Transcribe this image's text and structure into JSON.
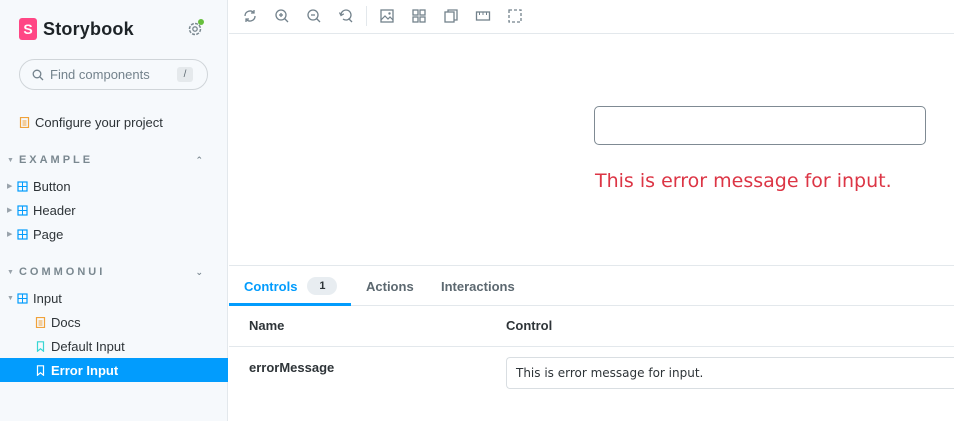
{
  "brand": {
    "name": "Storybook",
    "logo_letter": "S",
    "accent": "#ff4785"
  },
  "search": {
    "placeholder": "Find components",
    "shortcut": "/"
  },
  "sidebar": {
    "configure": "Configure your project",
    "sections": [
      {
        "title": "EXAMPLE",
        "items": [
          "Button",
          "Header",
          "Page"
        ]
      },
      {
        "title": "COMMONUI",
        "component": "Input",
        "stories": [
          "Docs",
          "Default Input",
          "Error Input"
        ]
      }
    ],
    "selected_color": "#029cfd"
  },
  "toolbar": {
    "icons": [
      "reload-icon",
      "zoom-in-icon",
      "zoom-out-icon",
      "zoom-reset-icon",
      "background-icon",
      "grid-icon",
      "viewport-icon",
      "measure-icon",
      "outline-icon"
    ]
  },
  "canvas": {
    "error_message": "This is error message for input.",
    "error_color": "#dc3545"
  },
  "panel": {
    "tabs": [
      {
        "label": "Controls",
        "badge": "1"
      },
      {
        "label": "Actions"
      },
      {
        "label": "Interactions"
      }
    ],
    "columns": {
      "name": "Name",
      "control": "Control"
    },
    "rows": [
      {
        "name": "errorMessage",
        "value": "This is error message for input."
      }
    ]
  }
}
